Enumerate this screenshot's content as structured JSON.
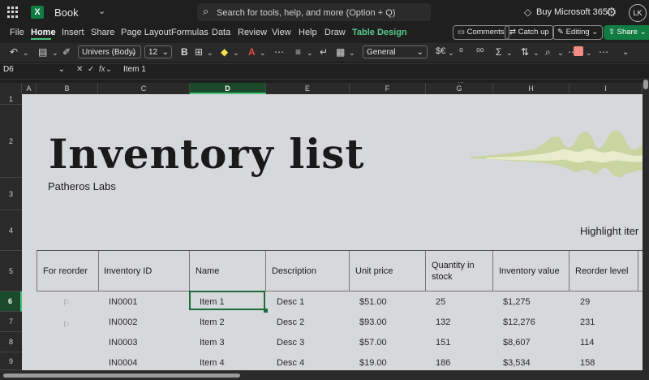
{
  "titlebar": {
    "app_name": "Book",
    "search_placeholder": "Search for tools, help, and more (Option + Q)",
    "buy_label": "Buy Microsoft 365",
    "avatar_initials": "LK",
    "logo_letter": "X"
  },
  "menu": {
    "items": [
      "File",
      "Home",
      "Insert",
      "Share",
      "Page Layout",
      "Formulas",
      "Data",
      "Review",
      "View",
      "Help",
      "Draw",
      "Table Design"
    ],
    "comments": "Comments",
    "catchup": "Catch up",
    "editing": "Editing",
    "share": "Share"
  },
  "ribbon": {
    "font_name": "Univers (Body)",
    "font_size": "12",
    "number_format": "General",
    "bold": "B"
  },
  "formula_bar": {
    "cell_ref": "D6",
    "fx": "fx",
    "content": "Item 1"
  },
  "grid": {
    "columns": [
      "A",
      "B",
      "C",
      "D",
      "E",
      "F",
      "G",
      "H",
      "I"
    ],
    "rows": [
      "1",
      "2",
      "3",
      "4",
      "5",
      "6",
      "7",
      "8",
      "9"
    ]
  },
  "sheet": {
    "title": "Inventory list",
    "company": "Patheros Labs",
    "highlight": "Highlight iter",
    "headers": [
      "For reorder",
      "Inventory ID",
      "Name",
      "Description",
      "Unit price",
      "Quantity in stock",
      "Inventory value",
      "Reorder level"
    ],
    "rows": [
      {
        "id": "IN0001",
        "name": "Item 1",
        "desc": "Desc 1",
        "price": "$51.00",
        "qty": "25",
        "value": "$1,275",
        "reorder": "29"
      },
      {
        "id": "IN0002",
        "name": "Item 2",
        "desc": "Desc 2",
        "price": "$93.00",
        "qty": "132",
        "value": "$12,276",
        "reorder": "231"
      },
      {
        "id": "IN0003",
        "name": "Item 3",
        "desc": "Desc 3",
        "price": "$57.00",
        "qty": "151",
        "value": "$8,607",
        "reorder": "114"
      },
      {
        "id": "IN0004",
        "name": "Item 4",
        "desc": "Desc 4",
        "price": "$19.00",
        "qty": "186",
        "value": "$3,534",
        "reorder": "158"
      }
    ]
  },
  "colors": {
    "accent": "#107c41",
    "selection": "#1e6b3a",
    "sheet_bg": "#d7d8db"
  }
}
